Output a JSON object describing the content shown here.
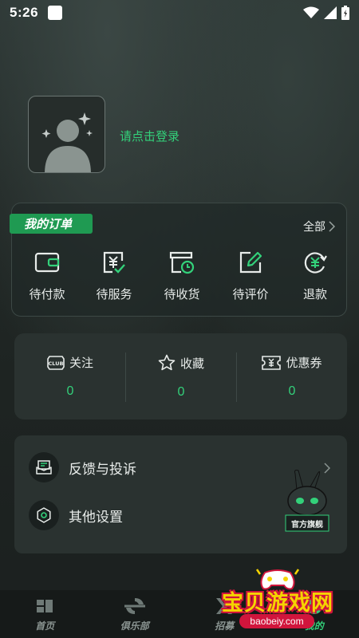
{
  "status_bar": {
    "time": "5:26"
  },
  "profile": {
    "login_text": "请点击登录"
  },
  "orders": {
    "title": "我的订单",
    "all_label": "全部",
    "items": [
      {
        "label": "待付款",
        "icon": "wallet-icon"
      },
      {
        "label": "待服务",
        "icon": "yen-check-icon"
      },
      {
        "label": "待收货",
        "icon": "box-clock-icon"
      },
      {
        "label": "待评价",
        "icon": "edit-icon"
      },
      {
        "label": "退款",
        "icon": "yen-refresh-icon"
      }
    ]
  },
  "stats": {
    "items": [
      {
        "label": "关注",
        "count": "0",
        "icon": "club-icon"
      },
      {
        "label": "收藏",
        "count": "0",
        "icon": "star-icon"
      },
      {
        "label": "优惠券",
        "count": "0",
        "icon": "coupon-icon"
      }
    ]
  },
  "menu": {
    "items": [
      {
        "label": "反馈与投诉",
        "icon": "feedback-icon"
      },
      {
        "label": "其他设置",
        "icon": "settings-icon"
      }
    ]
  },
  "mascot": {
    "label": "官方旗舰"
  },
  "bottom_nav": {
    "items": [
      {
        "label": "首页",
        "icon": "home-icon"
      },
      {
        "label": "俱乐部",
        "icon": "club-nav-icon"
      },
      {
        "label": "招募",
        "icon": "recruit-icon"
      },
      {
        "label": "我的",
        "icon": "profile-nav-icon",
        "active": true
      }
    ]
  },
  "watermark": {
    "title": "宝贝游戏网",
    "url": "baobeiy.com"
  },
  "colors": {
    "accent": "#33d17a",
    "tag_bg": "#1f9a52",
    "background": "#1d2322"
  }
}
